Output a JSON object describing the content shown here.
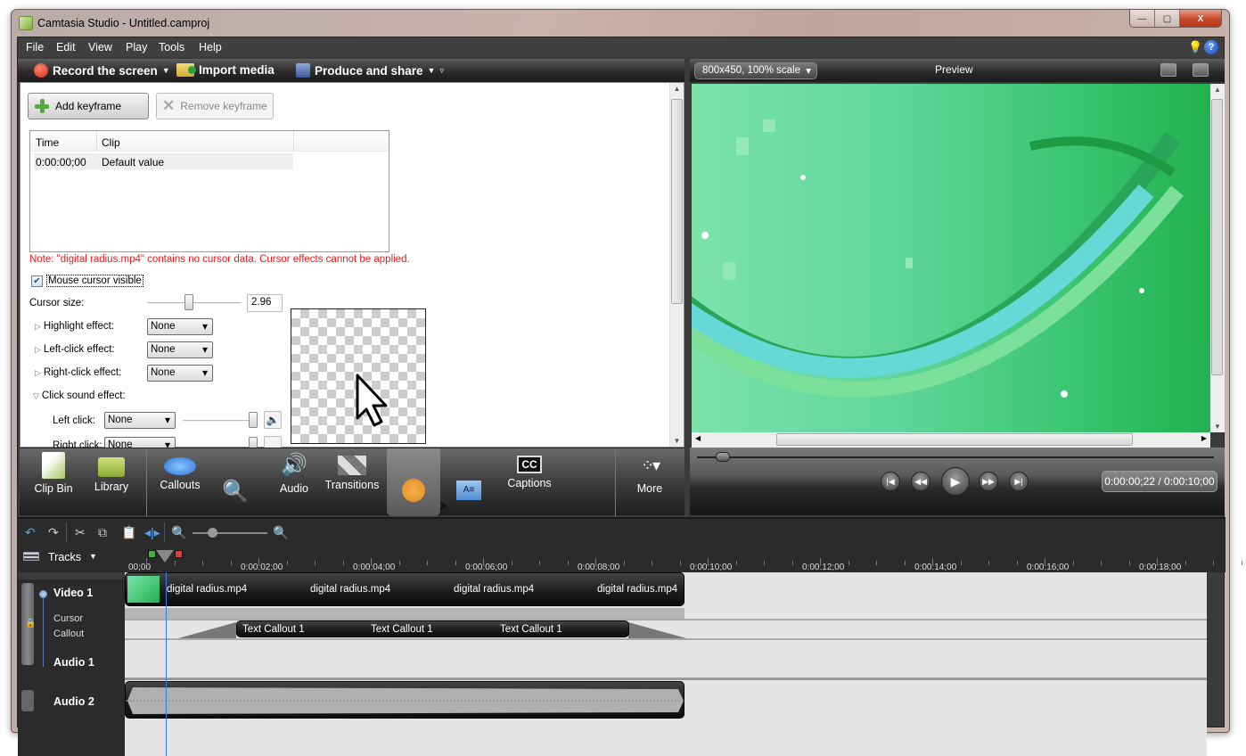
{
  "window": {
    "title": "Camtasia Studio - Untitled.camproj",
    "controls": {
      "minimize": "—",
      "maximize": "▢",
      "close": "X"
    }
  },
  "menu": [
    "File",
    "Edit",
    "View",
    "Play",
    "Tools",
    "Help"
  ],
  "menu_icons": {
    "tips": "lightbulb-icon",
    "help": "?"
  },
  "toolbar": {
    "record": "Record the screen",
    "import": "Import media",
    "produce": "Produce and share"
  },
  "cursor_panel": {
    "add_keyframe": "Add keyframe",
    "remove_keyframe": "Remove keyframe",
    "table": {
      "columns": [
        "Time",
        "Clip"
      ],
      "rows": [
        {
          "time": "0:00:00;00",
          "clip": "Default value"
        }
      ]
    },
    "note": "Note: \"digital radius.mp4\" contains no cursor data. Cursor effects cannot be applied.",
    "mouse_cursor_visible": {
      "label": "Mouse cursor visible",
      "checked": true
    },
    "cursor_size": {
      "label": "Cursor size:",
      "value": "2.96",
      "slider_fraction": 0.45
    },
    "highlight": {
      "label": "Highlight effect:",
      "value": "None"
    },
    "left_click": {
      "label": "Left-click effect:",
      "value": "None"
    },
    "right_click": {
      "label": "Right-click effect:",
      "value": "None"
    },
    "click_sound": {
      "label": "Click sound effect:",
      "left": {
        "label": "Left click:",
        "value": "None",
        "volume_fraction": 1.0
      },
      "right": {
        "label": "Right click:",
        "value": "None",
        "volume_fraction": 1.0
      }
    }
  },
  "tabs": [
    {
      "id": "clip-bin",
      "label": "Clip Bin"
    },
    {
      "id": "library",
      "label": "Library"
    },
    {
      "id": "callouts",
      "label": "Callouts"
    },
    {
      "id": "zoom-n-pan",
      "label": "Zoom-n-\nPan"
    },
    {
      "id": "audio",
      "label": "Audio"
    },
    {
      "id": "transitions",
      "label": "Transitions"
    },
    {
      "id": "cursor-effects",
      "label": "Cursor\nEffects",
      "active": true
    },
    {
      "id": "title-clips",
      "label": "Title\nClips"
    },
    {
      "id": "captions",
      "label": "Captions"
    },
    {
      "id": "more",
      "label": "More"
    }
  ],
  "preview": {
    "scale": "800x450, 100% scale",
    "title": "Preview",
    "position_fraction": 0.037,
    "time": "0:00:00;22 / 0:00:10;00"
  },
  "timeline": {
    "tracks_label": "Tracks",
    "ruler": [
      "00;00",
      "0:00:02;00",
      "0:00:04;00",
      "0:00:06;00",
      "0:00:08;00",
      "0:00:10;00",
      "0:00:12;00",
      "0:00:14;00",
      "0:00:16;00",
      "0:00:18;00"
    ],
    "tracks": {
      "video1": "Video 1",
      "cursor": "Cursor",
      "callout": "Callout",
      "audio1": "Audio 1",
      "audio2": "Audio 2"
    },
    "video_clip_labels": [
      "digital radius.mp4",
      "digital radius.mp4",
      "digital radius.mp4",
      "digital radius.mp4"
    ],
    "callout_labels": [
      "Text Callout 1",
      "Text Callout 1",
      "Text Callout 1"
    ]
  }
}
